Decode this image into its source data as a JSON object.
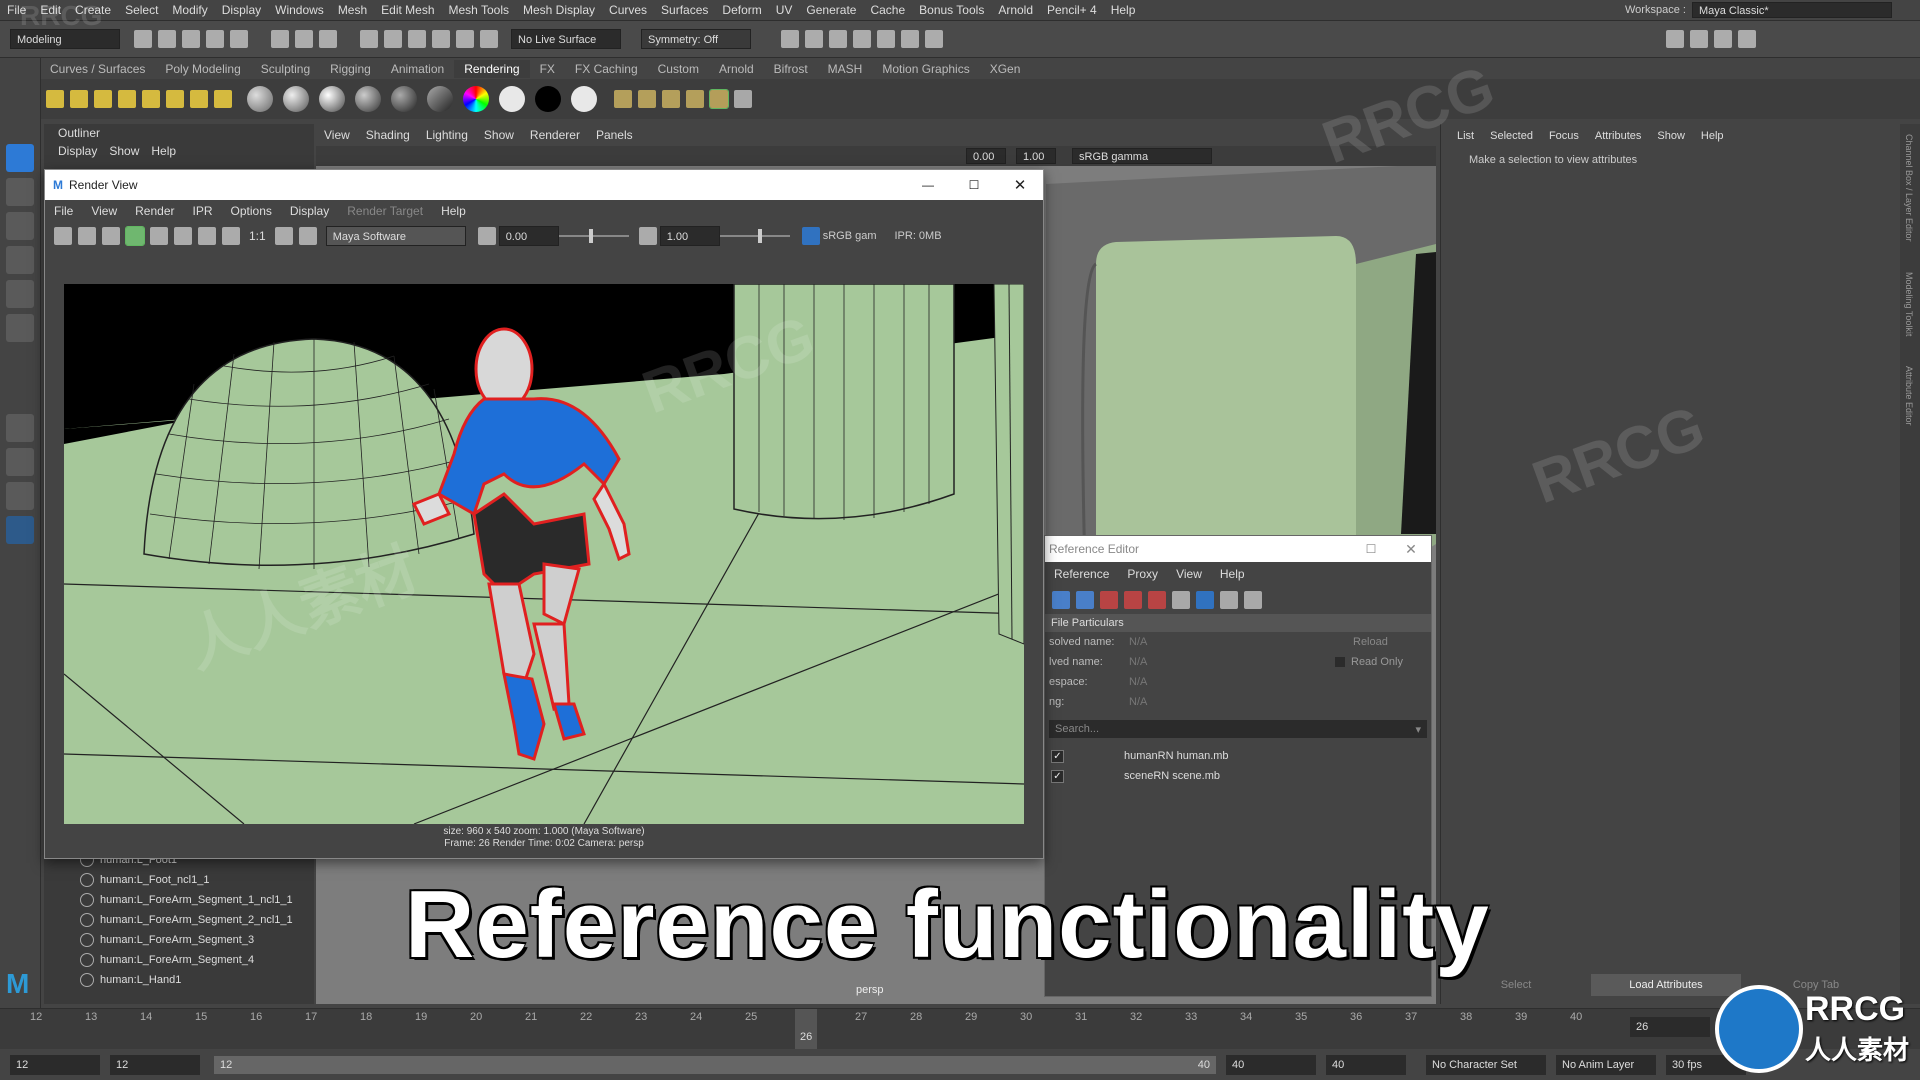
{
  "menubar": {
    "items": [
      "File",
      "Edit",
      "Create",
      "Select",
      "Modify",
      "Display",
      "Windows",
      "Mesh",
      "Edit Mesh",
      "Mesh Tools",
      "Mesh Display",
      "Curves",
      "Surfaces",
      "Deform",
      "UV",
      "Generate",
      "Cache",
      "Bonus Tools",
      "Arnold",
      "Pencil+ 4",
      "Help"
    ],
    "workspace_label": "Workspace :",
    "workspace_value": "Maya Classic*"
  },
  "status_line": {
    "mode": "Modeling",
    "live_surface": "No Live Surface",
    "symmetry": "Symmetry: Off"
  },
  "shelf": {
    "tabs": [
      "Curves / Surfaces",
      "Poly Modeling",
      "Sculpting",
      "Rigging",
      "Animation",
      "Rendering",
      "FX",
      "FX Caching",
      "Custom",
      "Arnold",
      "Bifrost",
      "MASH",
      "Motion Graphics",
      "XGen"
    ],
    "active_tab": "Rendering"
  },
  "outliner": {
    "title": "Outliner",
    "menu": [
      "Display",
      "Show",
      "Help"
    ],
    "items": [
      "human:L_Foot1",
      "human:L_Foot_ncl1_1",
      "human:L_ForeArm_Segment_1_ncl1_1",
      "human:L_ForeArm_Segment_2_ncl1_1",
      "human:L_ForeArm_Segment_3",
      "human:L_ForeArm_Segment_4",
      "human:L_Hand1"
    ]
  },
  "viewport": {
    "menu": [
      "View",
      "Shading",
      "Lighting",
      "Show",
      "Renderer",
      "Panels"
    ],
    "exposure": "0.00",
    "gamma": "1.00",
    "color_space": "sRGB gamma",
    "camera_label": "persp"
  },
  "render_view": {
    "title": "Render View",
    "menu": [
      "File",
      "View",
      "Render",
      "IPR",
      "Options",
      "Display",
      "Render Target",
      "Help"
    ],
    "ratio": "1:1",
    "renderer": "Maya Software",
    "exposure": "0.00",
    "gamma": "1.00",
    "color_space": "sRGB gam",
    "ipr_memory": "IPR: 0MB",
    "status_line1": "size: 960 x 540  zoom: 1.000      (Maya Software)",
    "status_line2": "Frame: 26      Render Time: 0:02      Camera: persp"
  },
  "channel_box": {
    "menu": [
      "List",
      "Selected",
      "Focus",
      "Attributes",
      "Show",
      "Help"
    ],
    "message": "Make a selection to view attributes",
    "select_button": "Select",
    "load_attributes_button": "Load Attributes",
    "copy_tab_button": "Copy Tab",
    "side_tabs": [
      "Channel Box / Layer Editor",
      "Modeling Toolkit",
      "Attribute Editor"
    ]
  },
  "reference_editor": {
    "title": "Reference Editor",
    "menu": [
      "Reference",
      "Proxy",
      "View",
      "Help"
    ],
    "section": "File Particulars",
    "fields": [
      {
        "label": "solved name:",
        "value": "N/A"
      },
      {
        "label": "lved name:",
        "value": "N/A"
      },
      {
        "label": "espace:",
        "value": "N/A"
      },
      {
        "label": "ng:",
        "value": "N/A"
      }
    ],
    "reload_button": "Reload",
    "read_only_label": "Read Only",
    "search_placeholder": "Search...",
    "references": [
      {
        "name": "humanRN human.mb",
        "checked": true
      },
      {
        "name": "sceneRN scene.mb",
        "checked": true
      }
    ]
  },
  "timeline": {
    "ticks": [
      "12",
      "13",
      "14",
      "15",
      "16",
      "17",
      "18",
      "19",
      "20",
      "21",
      "22",
      "23",
      "24",
      "25",
      "26",
      "27",
      "28",
      "29",
      "30",
      "31",
      "32",
      "33",
      "34",
      "35",
      "36",
      "37",
      "38",
      "39",
      "40"
    ],
    "current_frame": "26",
    "current_frame_field": "26"
  },
  "range_slider": {
    "start": "12",
    "playback_start": "12",
    "range_start": "12",
    "range_end": "40",
    "playback_end": "40",
    "end": "40",
    "character_set": "No Character Set",
    "anim_layer": "No Anim Layer",
    "fps": "30 fps"
  },
  "caption": "Reference functionality",
  "watermarks": [
    "RRCG",
    "人人素材"
  ],
  "colors": {
    "ui_dark": "#444444",
    "ground_green": "#a8c89a",
    "shirt_blue": "#1e6fd8",
    "outline_red": "#e02020",
    "active_blue": "#2d7ad6"
  }
}
